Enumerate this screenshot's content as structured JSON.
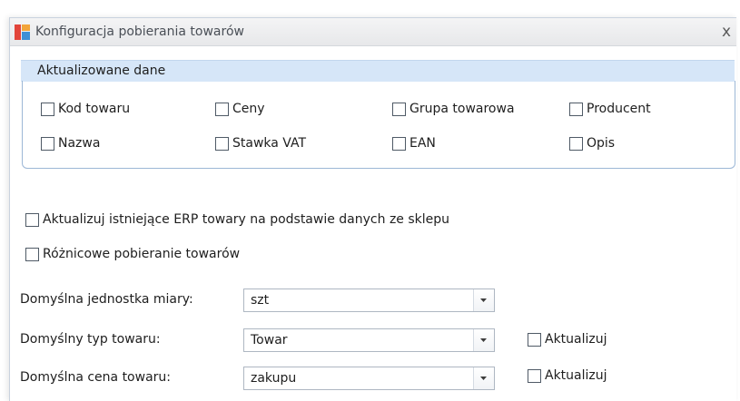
{
  "window": {
    "title": "Konfiguracja pobierania towarów",
    "close_glyph": "x",
    "icon": "app-logo-icon"
  },
  "group": {
    "header": "Aktualizowane dane",
    "checkboxes": [
      {
        "label": "Kod towaru",
        "checked": false
      },
      {
        "label": "Ceny",
        "checked": false
      },
      {
        "label": "Grupa towarowa",
        "checked": false
      },
      {
        "label": "Producent",
        "checked": false
      },
      {
        "label": "Nazwa",
        "checked": false
      },
      {
        "label": "Stawka VAT",
        "checked": false
      },
      {
        "label": "EAN",
        "checked": false
      },
      {
        "label": "Opis",
        "checked": false
      }
    ]
  },
  "options": {
    "update_existing": {
      "label": "Aktualizuj istniejące ERP towary na podstawie danych ze sklepu",
      "checked": false
    },
    "diff_download": {
      "label": "Różnicowe pobieranie towarów",
      "checked": false
    }
  },
  "fields": {
    "unit": {
      "label": "Domyślna jednostka miary:",
      "value": "szt"
    },
    "type": {
      "label": "Domyślny typ towaru:",
      "value": "Towar",
      "update_label": "Aktualizuj",
      "update_checked": false
    },
    "price": {
      "label": "Domyślna cena towaru:",
      "value": "zakupu",
      "update_label": "Aktualizuj",
      "update_checked": false
    }
  },
  "colors": {
    "group_header": "#d6e6f8",
    "group_border": "#9cb7d6"
  }
}
